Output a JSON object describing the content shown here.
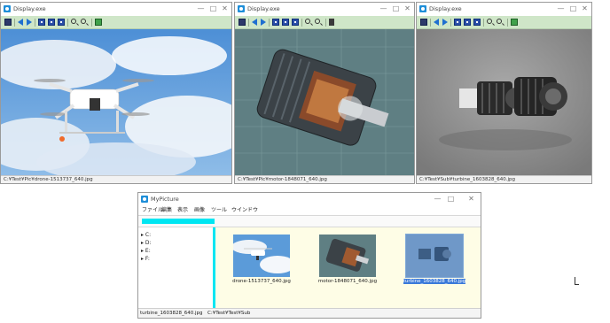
{
  "viewer_windows": [
    {
      "title": "Display.exe",
      "controls": {
        "minimize": "—",
        "maximize": "□",
        "close": "✕"
      },
      "status_path": "C:¥Test¥Pic¥drone-1513737_640.jpg",
      "image_subject": "quadcopter drone flying in cloudy blue sky"
    },
    {
      "title": "Display.exe",
      "controls": {
        "minimize": "—",
        "maximize": "□",
        "close": "✕"
      },
      "status_path": "C:¥Test¥Pic¥motor-1848071_640.jpg",
      "image_subject": "cutaway electric motor on circuit background"
    },
    {
      "title": "Display.exe",
      "controls": {
        "minimize": "—",
        "maximize": "□",
        "close": "✕"
      },
      "status_path": "C:¥Test¥Sub¥turbine_1603828_640.jpg",
      "image_subject": "twin turbine engines on grey background"
    }
  ],
  "mypicture": {
    "title": "MyPicture",
    "controls": {
      "minimize": "—",
      "maximize": "□",
      "close": "✕"
    },
    "menu": [
      "ファイル",
      "編集",
      "表示",
      "画像",
      "ツール",
      "ウインドウ"
    ],
    "tree": [
      "C:",
      "D:",
      "E:",
      "F:"
    ],
    "thumbnails": [
      {
        "caption": "drone-1513737_640.jpg",
        "selected": false
      },
      {
        "caption": "motor-1848071_640.jpg",
        "selected": false
      },
      {
        "caption": "turbine_1603828_640.jpg",
        "selected": true
      }
    ],
    "status_left": "turbine_1603828_640.jpg",
    "status_right": "C:¥Test¥Test¥Sub"
  },
  "colors": {
    "toolbar_bg": "#cfe6c8",
    "address_fill": "#00e6f2",
    "thumb_pane_bg": "#fefde6",
    "selection": "#3a79d9",
    "icon_blue": "#1e8ed8"
  }
}
